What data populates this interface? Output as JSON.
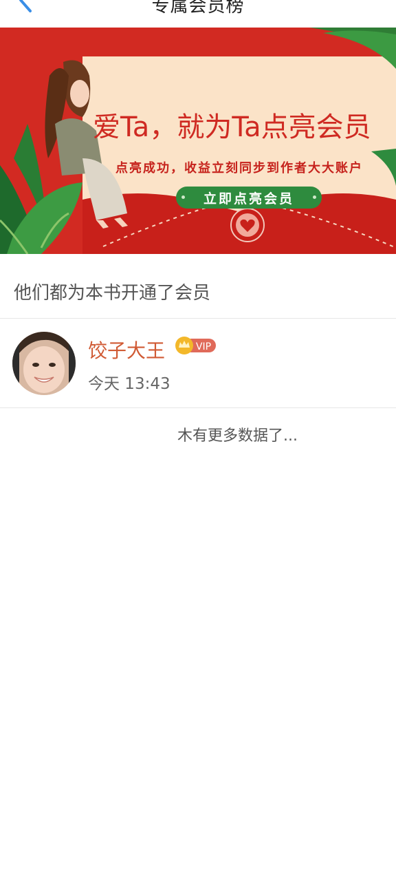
{
  "header": {
    "title": "专属会员榜"
  },
  "banner": {
    "title": "爱Ta，就为Ta点亮会员",
    "subtitle": "点亮成功，收益立刻同步到作者大大账户",
    "button_label": "立即点亮会员"
  },
  "section": {
    "heading": "他们都为本书开通了会员"
  },
  "members": [
    {
      "name": "饺子大王",
      "badge": "VIP",
      "time": "今天 13:43"
    }
  ],
  "footer": {
    "no_more_text": "木有更多数据了..."
  },
  "colors": {
    "banner_red": "#d22a22",
    "accent_green": "#2e8b3e",
    "name_color": "#d05a34",
    "back_icon_blue": "#3a8ee6"
  }
}
